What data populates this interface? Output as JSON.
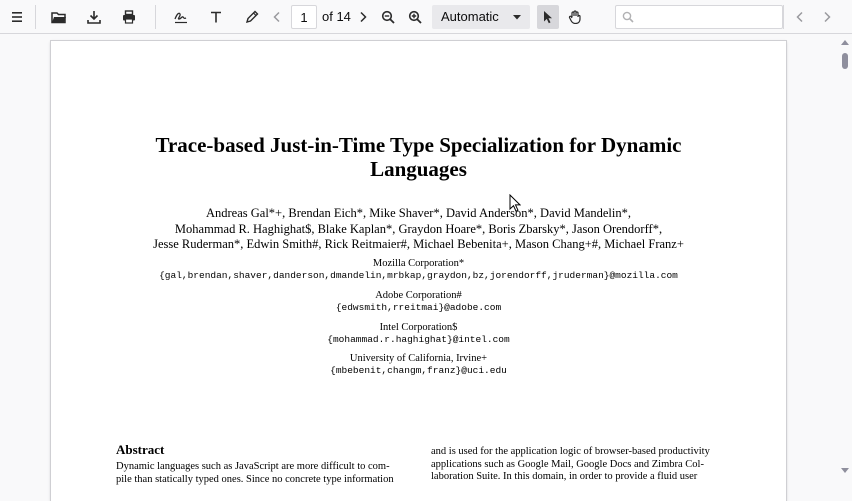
{
  "toolbar": {
    "sidebar_toggle_icon": "sidebar-toggle-icon",
    "page_number": "1",
    "page_count_label": "of 14",
    "zoom_value": "Automatic",
    "search_placeholder": ""
  },
  "document": {
    "title_line1": "Trace-based Just-in-Time Type Specialization for Dynamic",
    "title_line2": "Languages",
    "authors_line1": "Andreas Gal*+, Brendan Eich*, Mike Shaver*, David Anderson*, David Mandelin*,",
    "authors_line2": "Mohammad R. Haghighat$, Blake Kaplan*, Graydon Hoare*, Boris Zbarsky*, Jason Orendorff*,",
    "authors_line3": "Jesse Ruderman*, Edwin Smith#, Rick Reitmaier#, Michael Bebenita+, Mason Chang+#, Michael Franz+",
    "affiliations": [
      {
        "name": "Mozilla Corporation*",
        "emails": "{gal,brendan,shaver,danderson,dmandelin,mrbkap,graydon,bz,jorendorff,jruderman}@mozilla.com"
      },
      {
        "name": "Adobe Corporation#",
        "emails": "{edwsmith,rreitmai}@adobe.com"
      },
      {
        "name": "Intel Corporation$",
        "emails": "{mohammad.r.haghighat}@intel.com"
      },
      {
        "name": "University of California, Irvine+",
        "emails": "{mbebenit,changm,franz}@uci.edu"
      }
    ],
    "abstract_heading": "Abstract",
    "abstract_line1": "Dynamic languages such as JavaScript are more difficult to com-",
    "abstract_line2": "pile than statically typed ones. Since no concrete type information",
    "right_line1": "and is used for the application logic of browser-based productivity",
    "right_line2": "applications such as Google Mail, Google Docs and Zimbra Col-",
    "right_line3": "laboration Suite. In this domain, in order to provide a fluid user"
  }
}
